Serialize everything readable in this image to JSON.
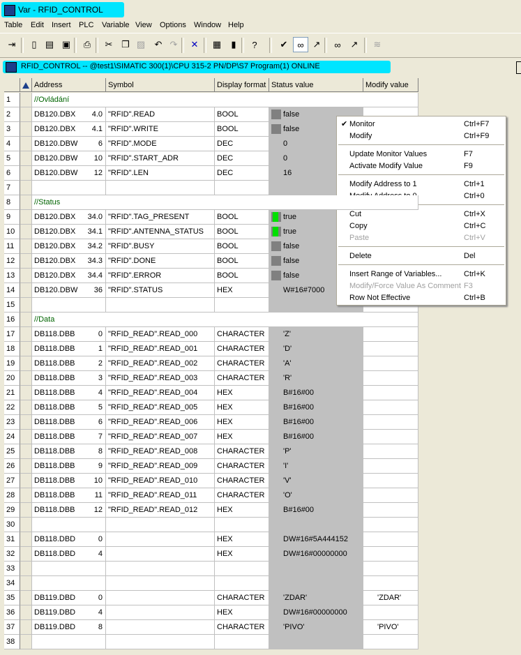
{
  "window": {
    "title": "Var - RFID_CONTROL"
  },
  "menu": [
    "Table",
    "Edit",
    "Insert",
    "PLC",
    "Variable",
    "View",
    "Options",
    "Window",
    "Help"
  ],
  "toolbar_icons": [
    "pin-icon",
    "new-icon",
    "open-icon",
    "save-icon",
    "print-icon",
    "cut-icon",
    "copy-icon",
    "paste-icon",
    "undo-icon",
    "redo-icon",
    "delete-icon",
    "plc-icon",
    "tag-icon",
    "help-icon",
    "monitor-icon",
    "glasses-icon",
    "modify-icon",
    "glasses-2-icon",
    "modify-2-icon",
    "force-icon"
  ],
  "subwindow": {
    "title": "RFID_CONTROL  --  @test1\\SIMATIC 300(1)\\CPU 315-2 PN/DP\\S7 Program(1)  ONLINE"
  },
  "columns": [
    "Address",
    "Symbol",
    "Display format",
    "Status value",
    "Modify value"
  ],
  "rows": [
    {
      "n": "1",
      "comment": "//Ovládání"
    },
    {
      "n": "2",
      "addr": "DB120.DBX",
      "off": "4.0",
      "sym": "\"RFID\".READ",
      "fmt": "BOOL",
      "val": "false",
      "ind": "gray"
    },
    {
      "n": "3",
      "addr": "DB120.DBX",
      "off": "4.1",
      "sym": "\"RFID\".WRITE",
      "fmt": "BOOL",
      "val": "false",
      "ind": "gray"
    },
    {
      "n": "4",
      "addr": "DB120.DBW",
      "off": "6",
      "sym": "\"RFID\".MODE",
      "fmt": "DEC",
      "val": "0"
    },
    {
      "n": "5",
      "addr": "DB120.DBW",
      "off": "10",
      "sym": "\"RFID\".START_ADR",
      "fmt": "DEC",
      "val": "0"
    },
    {
      "n": "6",
      "addr": "DB120.DBW",
      "off": "12",
      "sym": "\"RFID\".LEN",
      "fmt": "DEC",
      "val": "16"
    },
    {
      "n": "7"
    },
    {
      "n": "8",
      "comment": "//Status"
    },
    {
      "n": "9",
      "addr": "DB120.DBX",
      "off": "34.0",
      "sym": "\"RFID\".TAG_PRESENT",
      "fmt": "BOOL",
      "val": "true",
      "ind": "green"
    },
    {
      "n": "10",
      "addr": "DB120.DBX",
      "off": "34.1",
      "sym": "\"RFID\".ANTENNA_STATUS",
      "fmt": "BOOL",
      "val": "true",
      "ind": "green"
    },
    {
      "n": "11",
      "addr": "DB120.DBX",
      "off": "34.2",
      "sym": "\"RFID\".BUSY",
      "fmt": "BOOL",
      "val": "false",
      "ind": "gray"
    },
    {
      "n": "12",
      "addr": "DB120.DBX",
      "off": "34.3",
      "sym": "\"RFID\".DONE",
      "fmt": "BOOL",
      "val": "false",
      "ind": "gray"
    },
    {
      "n": "13",
      "addr": "DB120.DBX",
      "off": "34.4",
      "sym": "\"RFID\".ERROR",
      "fmt": "BOOL",
      "val": "false",
      "ind": "gray"
    },
    {
      "n": "14",
      "addr": "DB120.DBW",
      "off": "36",
      "sym": "\"RFID\".STATUS",
      "fmt": "HEX",
      "val": "W#16#7000"
    },
    {
      "n": "15"
    },
    {
      "n": "16",
      "comment": "//Data"
    },
    {
      "n": "17",
      "addr": "DB118.DBB",
      "off": "0",
      "sym": "\"RFID_READ\".READ_000",
      "fmt": "CHARACTER",
      "val": "'Z'"
    },
    {
      "n": "18",
      "addr": "DB118.DBB",
      "off": "1",
      "sym": "\"RFID_READ\".READ_001",
      "fmt": "CHARACTER",
      "val": "'D'"
    },
    {
      "n": "19",
      "addr": "DB118.DBB",
      "off": "2",
      "sym": "\"RFID_READ\".READ_002",
      "fmt": "CHARACTER",
      "val": "'A'"
    },
    {
      "n": "20",
      "addr": "DB118.DBB",
      "off": "3",
      "sym": "\"RFID_READ\".READ_003",
      "fmt": "CHARACTER",
      "val": "'R'"
    },
    {
      "n": "21",
      "addr": "DB118.DBB",
      "off": "4",
      "sym": "\"RFID_READ\".READ_004",
      "fmt": "HEX",
      "val": "B#16#00"
    },
    {
      "n": "22",
      "addr": "DB118.DBB",
      "off": "5",
      "sym": "\"RFID_READ\".READ_005",
      "fmt": "HEX",
      "val": "B#16#00"
    },
    {
      "n": "23",
      "addr": "DB118.DBB",
      "off": "6",
      "sym": "\"RFID_READ\".READ_006",
      "fmt": "HEX",
      "val": "B#16#00"
    },
    {
      "n": "24",
      "addr": "DB118.DBB",
      "off": "7",
      "sym": "\"RFID_READ\".READ_007",
      "fmt": "HEX",
      "val": "B#16#00"
    },
    {
      "n": "25",
      "addr": "DB118.DBB",
      "off": "8",
      "sym": "\"RFID_READ\".READ_008",
      "fmt": "CHARACTER",
      "val": "'P'"
    },
    {
      "n": "26",
      "addr": "DB118.DBB",
      "off": "9",
      "sym": "\"RFID_READ\".READ_009",
      "fmt": "CHARACTER",
      "val": "'I'"
    },
    {
      "n": "27",
      "addr": "DB118.DBB",
      "off": "10",
      "sym": "\"RFID_READ\".READ_010",
      "fmt": "CHARACTER",
      "val": "'V'"
    },
    {
      "n": "28",
      "addr": "DB118.DBB",
      "off": "11",
      "sym": "\"RFID_READ\".READ_011",
      "fmt": "CHARACTER",
      "val": "'O'"
    },
    {
      "n": "29",
      "addr": "DB118.DBB",
      "off": "12",
      "sym": "\"RFID_READ\".READ_012",
      "fmt": "HEX",
      "val": "B#16#00"
    },
    {
      "n": "30"
    },
    {
      "n": "31",
      "addr": "DB118.DBD",
      "off": "0",
      "fmt": "HEX",
      "val": "DW#16#5A444152"
    },
    {
      "n": "32",
      "addr": "DB118.DBD",
      "off": "4",
      "fmt": "HEX",
      "val": "DW#16#00000000"
    },
    {
      "n": "33"
    },
    {
      "n": "34"
    },
    {
      "n": "35",
      "addr": "DB119.DBD",
      "off": "0",
      "fmt": "CHARACTER",
      "val": "'ZDAR'",
      "mod": "'ZDAR'"
    },
    {
      "n": "36",
      "addr": "DB119.DBD",
      "off": "4",
      "fmt": "HEX",
      "val": "DW#16#00000000"
    },
    {
      "n": "37",
      "addr": "DB119.DBD",
      "off": "8",
      "fmt": "CHARACTER",
      "val": "'PIVO'",
      "mod": "'PIVO'"
    },
    {
      "n": "38"
    }
  ],
  "context_menu": [
    {
      "label": "Monitor",
      "shortcut": "Ctrl+F7",
      "checked": true
    },
    {
      "label": "Modify",
      "shortcut": "Ctrl+F9"
    },
    {
      "sep": true
    },
    {
      "label": "Update Monitor Values",
      "shortcut": "F7"
    },
    {
      "label": "Activate Modify Value",
      "shortcut": "F9"
    },
    {
      "sep": true
    },
    {
      "label": "Modify Address to 1",
      "shortcut": "Ctrl+1"
    },
    {
      "label": "Modify Address to 0",
      "shortcut": "Ctrl+0"
    },
    {
      "sep": true
    },
    {
      "label": "Cut",
      "shortcut": "Ctrl+X"
    },
    {
      "label": "Copy",
      "shortcut": "Ctrl+C"
    },
    {
      "label": "Paste",
      "shortcut": "Ctrl+V",
      "disabled": true
    },
    {
      "sep": true
    },
    {
      "label": "Delete",
      "shortcut": "Del"
    },
    {
      "sep": true
    },
    {
      "label": "Insert Range of Variables...",
      "shortcut": "Ctrl+K"
    },
    {
      "label": "Modify/Force Value As Comment",
      "shortcut": "F3",
      "disabled": true
    },
    {
      "label": "Row Not Effective",
      "shortcut": "Ctrl+B"
    }
  ]
}
